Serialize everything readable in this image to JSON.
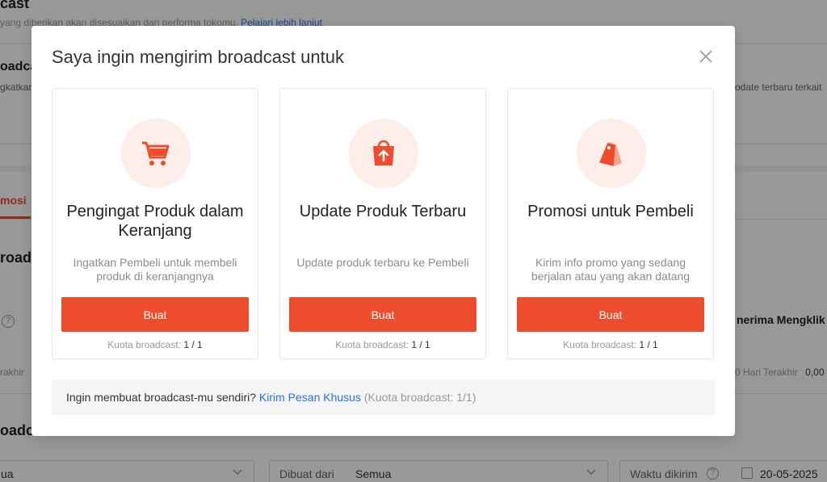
{
  "background": {
    "heading_fragment": "cast",
    "subtext": "yang diberikan akan disesuaikan dari performa tokomu.",
    "subtext_link": "Pelajari lebih lanjut",
    "section_label": "oadca",
    "section_sub_left": "gkatkan",
    "section_sub_right": "odate terbaru terkait",
    "tab_label": "mosi",
    "section2_label": "road",
    "metric_label": "nerima Mengklik",
    "left_hint": "rakhir",
    "right_hint": "0 Hari Terakhir",
    "right_value": "0,00",
    "section3_label": "oadca",
    "select1_value": "ua",
    "select2_label": "Dibuat dari",
    "select2_value": "Semua",
    "select3_label": "Waktu dikirim",
    "select3_value": "20-05-2025"
  },
  "modal": {
    "title": "Saya ingin mengirim broadcast untuk",
    "close_icon": "close-icon",
    "cards": [
      {
        "icon": "cart-icon",
        "title": "Pengingat Produk dalam Keranjang",
        "description": "Ingatkan Pembeli untuk membeli produk di keranjangnya",
        "button": "Buat",
        "quota_label": "Kuota broadcast:",
        "quota_value": "1 / 1"
      },
      {
        "icon": "bag-upload-icon",
        "title": "Update Produk Terbaru",
        "description": "Update produk terbaru ke Pembeli",
        "button": "Buat",
        "quota_label": "Kuota broadcast:",
        "quota_value": "1 / 1"
      },
      {
        "icon": "price-tag-icon",
        "title": "Promosi untuk Pembeli",
        "description": "Kirim info promo yang sedang berjalan atau yang akan datang",
        "button": "Buat",
        "quota_label": "Kuota broadcast:",
        "quota_value": "1 / 1"
      }
    ],
    "footer": {
      "text": "Ingin membuat broadcast-mu sendiri?",
      "link": "Kirim Pesan Khusus",
      "quota": "(Kuota broadcast: 1/1)"
    }
  },
  "colors": {
    "accent": "#ee4d2d",
    "icon_bg": "#fdeeea",
    "link": "#2673dd"
  }
}
